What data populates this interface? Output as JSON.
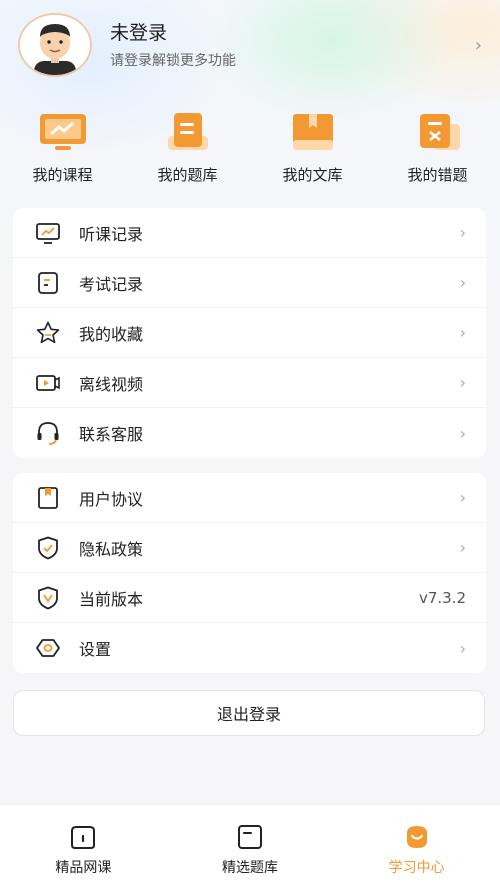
{
  "profile": {
    "name": "未登录",
    "subtitle": "请登录解锁更多功能"
  },
  "quick_links": [
    {
      "label": "我的课程",
      "icon": "monitor-chart-icon"
    },
    {
      "label": "我的题库",
      "icon": "question-bank-icon"
    },
    {
      "label": "我的文库",
      "icon": "book-library-icon"
    },
    {
      "label": "我的错题",
      "icon": "wrong-question-icon"
    }
  ],
  "menu_group_1": [
    {
      "label": "听课记录",
      "icon": "monitor-icon"
    },
    {
      "label": "考试记录",
      "icon": "exam-record-icon"
    },
    {
      "label": "我的收藏",
      "icon": "star-icon"
    },
    {
      "label": "离线视频",
      "icon": "offline-video-icon"
    },
    {
      "label": "联系客服",
      "icon": "headset-icon"
    }
  ],
  "menu_group_2": [
    {
      "label": "用户协议",
      "icon": "bookmark-doc-icon"
    },
    {
      "label": "隐私政策",
      "icon": "shield-check-icon"
    },
    {
      "label": "当前版本",
      "icon": "version-shield-icon",
      "value": "v7.3.2"
    },
    {
      "label": "设置",
      "icon": "gear-icon"
    }
  ],
  "logout_label": "退出登录",
  "tabs": [
    {
      "label": "精品网课",
      "icon": "course-tab-icon"
    },
    {
      "label": "精选题库",
      "icon": "question-tab-icon"
    },
    {
      "label": "学习中心",
      "icon": "study-center-icon",
      "active": true
    }
  ],
  "colors": {
    "accent": "#f29933",
    "accent_light": "#ffd7a8"
  }
}
